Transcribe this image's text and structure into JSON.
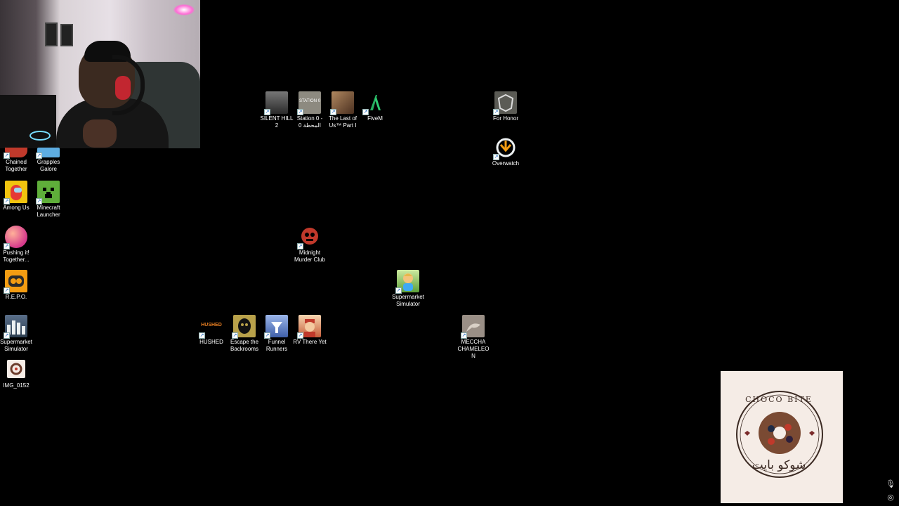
{
  "desktop": {
    "icons": [
      {
        "id": "chained-together",
        "label": "Chained Together",
        "icon": "chained-together-icon",
        "bg": "#c0392b"
      },
      {
        "id": "grapples-galore",
        "label": "Grapples Galore",
        "icon": "grapples-galore-icon",
        "bg": "#5dade2"
      },
      {
        "id": "among-us",
        "label": "Among Us",
        "icon": "among-us-icon",
        "bg": "#e53935"
      },
      {
        "id": "minecraft-launcher",
        "label": "Minecraft Launcher",
        "icon": "minecraft-icon",
        "bg": "#4caf50"
      },
      {
        "id": "pushing-it-together",
        "label": "Pushing it! Together...",
        "icon": "pushing-it-icon",
        "bg": "#ff6f61"
      },
      {
        "id": "repo",
        "label": "R.E.P.O.",
        "icon": "repo-icon",
        "bg": "#f39c12"
      },
      {
        "id": "supermarket-simulator-1",
        "label": "Supermarket Simulator",
        "icon": "supermarket-city-icon",
        "bg": "#2c3e50"
      },
      {
        "id": "img-0152",
        "label": "IMG_0152",
        "icon": "image-file-icon",
        "bg": "#f5ece6"
      },
      {
        "id": "silent-hill-2",
        "label": "SILENT HILL 2",
        "icon": "silent-hill-icon",
        "bg": "#555555"
      },
      {
        "id": "station-0",
        "label": "Station 0 - المحطة 0",
        "icon": "station-0-icon",
        "bg": "#8d8a80"
      },
      {
        "id": "the-last-of-us",
        "label": "The Last of Us™ Part I",
        "icon": "last-of-us-icon",
        "bg": "#7a5a3a"
      },
      {
        "id": "fivem",
        "label": "FiveM",
        "icon": "fivem-icon",
        "bg": "#000000"
      },
      {
        "id": "for-honor",
        "label": "For Honor",
        "icon": "for-honor-icon",
        "bg": "#5b5b55"
      },
      {
        "id": "overwatch",
        "label": "Overwatch",
        "icon": "overwatch-icon",
        "bg": "#000000"
      },
      {
        "id": "midnight-murder-club",
        "label": "Midnight Murder Club",
        "icon": "midnight-murder-icon",
        "bg": "#000000"
      },
      {
        "id": "supermarket-simulator-2",
        "label": "Supermarket Simulator",
        "icon": "supermarket-cashier-icon",
        "bg": "#8bc34a"
      },
      {
        "id": "hushed",
        "label": "HUSHED",
        "icon": "hushed-icon",
        "bg": "#000000"
      },
      {
        "id": "escape-backrooms",
        "label": "Escape the Backrooms",
        "icon": "backrooms-icon",
        "bg": "#b8a14a"
      },
      {
        "id": "funnel-runners",
        "label": "Funnel Runners",
        "icon": "funnel-runners-icon",
        "bg": "#5c7cc4"
      },
      {
        "id": "rv-there-yet",
        "label": "RV There Yet",
        "icon": "rv-there-yet-icon",
        "bg": "#e0a070"
      },
      {
        "id": "meccha-chameleon",
        "label": "MECCHA CHAMELEON",
        "icon": "meccha-chameleon-icon",
        "bg": "#9a8f86"
      }
    ]
  },
  "overlay": {
    "promo": {
      "brand_en": "CHOCO BITE",
      "brand_ar": "شوكو بايت",
      "bg": "#f5ece6"
    },
    "hushed_logo_text": "HUSHED",
    "station_logo_text": "STATION 0"
  },
  "tray": {
    "mic_icon": "microphone-icon",
    "location_icon": "location-icon"
  }
}
